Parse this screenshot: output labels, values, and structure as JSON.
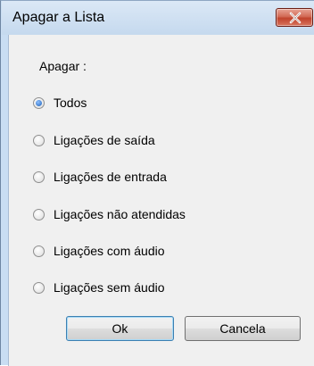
{
  "window": {
    "title": "Apagar a Lista"
  },
  "group": {
    "label": "Apagar :"
  },
  "options": [
    {
      "label": "Todos",
      "checked": true
    },
    {
      "label": "Ligações de saída",
      "checked": false
    },
    {
      "label": "Ligações de entrada",
      "checked": false
    },
    {
      "label": "Ligações não atendidas",
      "checked": false
    },
    {
      "label": "Ligações com áudio",
      "checked": false
    },
    {
      "label": "Ligações sem áudio",
      "checked": false
    }
  ],
  "buttons": {
    "ok_label": "Ok",
    "cancel_label": "Cancela"
  },
  "colors": {
    "title_bar": "#c9ddf2",
    "close_button": "#c0432c",
    "dialog_background": "#f0f0f0",
    "radio_selected": "#1c5fb8",
    "ok_border": "#3c7fb1"
  }
}
